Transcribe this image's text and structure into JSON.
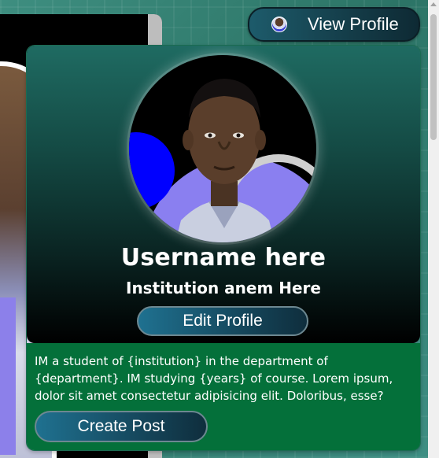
{
  "header": {
    "view_profile_label": "View Profile",
    "avatar_icon": "user-avatar"
  },
  "profile": {
    "username": "Username here",
    "institution": "Institution anem Here",
    "edit_profile_label": "Edit Profile",
    "bio": "IM a student of {institution} in the department of {department}. IM studying {years} of course. Lorem ipsum, dolor sit amet consectetur adipisicing elit. Doloribus, esse?",
    "create_post_label": "Create Post"
  },
  "colors": {
    "card_bottom": "#04703a",
    "card_top_gradient_start": "#1f6b62",
    "button_gradient_start": "#1f7190",
    "avatar_accent_blue": "#0000ff",
    "avatar_accent_purple": "#8a7ff0"
  }
}
